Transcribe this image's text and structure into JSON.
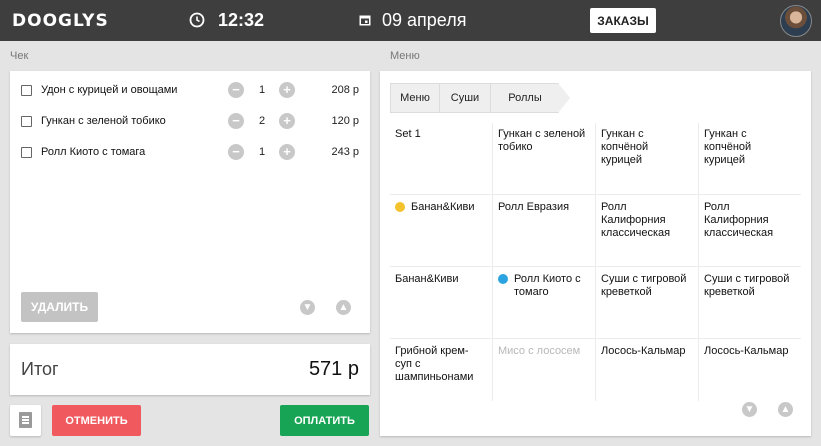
{
  "header": {
    "logo": "DOOGLYS",
    "time": "12:32",
    "date": "09 апреля",
    "orders_button": "ЗАКАЗЫ"
  },
  "check": {
    "section_label": "Чек",
    "items": [
      {
        "name": "Удон с курицей и овощами",
        "qty": "1",
        "price": "208 р"
      },
      {
        "name": "Гункан с зеленой тобико",
        "qty": "2",
        "price": "120 р"
      },
      {
        "name": "Ролл Киото с томага",
        "qty": "1",
        "price": "243 р"
      }
    ],
    "delete_button": "УДАЛИТЬ",
    "minus_glyph": "−",
    "plus_glyph": "+",
    "down_glyph": "▼",
    "up_glyph": "▲"
  },
  "total": {
    "label": "Итог",
    "value": "571 р"
  },
  "actions": {
    "cancel": "ОТМЕНИТЬ",
    "pay": "ОПЛАТИТЬ"
  },
  "menu": {
    "section_label": "Меню",
    "breadcrumbs": [
      "Меню",
      "Суши",
      "Роллы"
    ],
    "cells": [
      {
        "name": "Set 1"
      },
      {
        "name": "Гункан с зеленой тобико"
      },
      {
        "name": "Гункан с копчёной курицей"
      },
      {
        "name": "Гункан с копчёной курицей"
      },
      {
        "name": "Банан&Киви",
        "dot_color": "#f4c22b"
      },
      {
        "name": "Ролл Евразия"
      },
      {
        "name": "Ролл Калифорния классическая"
      },
      {
        "name": "Ролл Калифорния классическая"
      },
      {
        "name": "Банан&Киви"
      },
      {
        "name": "Ролл Киото с томаго",
        "dot_color": "#2aa3e0"
      },
      {
        "name": "Суши с тигровой креветкой"
      },
      {
        "name": "Суши с тигровой креветкой"
      },
      {
        "name": "Грибной крем-суп с шампиньонами"
      },
      {
        "name": "Мисо с лососем",
        "disabled": true
      },
      {
        "name": "Лосось-Кальмар"
      },
      {
        "name": "Лосось-Кальмар"
      }
    ]
  },
  "colors": {
    "topbar": "#3e3e3e",
    "cancel": "#f0595d",
    "pay": "#17a455"
  }
}
